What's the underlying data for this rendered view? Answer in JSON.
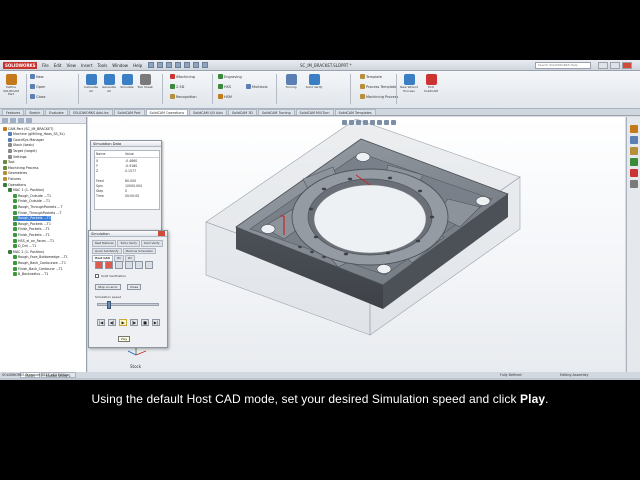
{
  "app": {
    "logo_text": "SOLIDWORKS",
    "menu": [
      "File",
      "Edit",
      "View",
      "Insert",
      "Tools",
      "Window",
      "Help"
    ],
    "document_title": "SC_IM_BRACKET.SLDPRT *",
    "search_placeholder": "Search SOLIDWORKS Help"
  },
  "ribbon": {
    "buttons": [
      {
        "label": "Define SOLIDCAM Part",
        "icon": "camworks-part-icon"
      },
      {
        "label": "New",
        "icon": "new-icon"
      },
      {
        "label": "Open",
        "icon": "open-icon"
      },
      {
        "label": "Close",
        "icon": "close-doc-icon"
      },
      {
        "label": "Calculate All",
        "icon": "calculate-icon"
      },
      {
        "label": "Generate All",
        "icon": "generate-icon"
      },
      {
        "label": "Simulate",
        "icon": "simulate-icon"
      },
      {
        "label": "Tool Sheet",
        "icon": "tool-sheet-icon"
      },
      {
        "label": "iMachining",
        "icon": "imachining-icon"
      },
      {
        "label": "2.5D",
        "icon": "milling-25d-icon"
      },
      {
        "label": "Recognition",
        "icon": "recognition-icon"
      },
      {
        "label": "Engraving",
        "icon": "engraving-icon"
      },
      {
        "label": "HSS",
        "icon": "hss-icon"
      },
      {
        "label": "HSM",
        "icon": "hsm-icon"
      },
      {
        "label": "Multiaxis",
        "icon": "multiaxis-icon"
      },
      {
        "label": "Turning",
        "icon": "turning-icon"
      },
      {
        "label": "Solid Verify",
        "icon": "verify-icon"
      },
      {
        "label": "Template",
        "icon": "template-icon"
      },
      {
        "label": "Process Template",
        "icon": "process-template-icon"
      },
      {
        "label": "Machining Process",
        "icon": "machining-process-icon"
      },
      {
        "label": "New Wizard Process",
        "icon": "wizard-icon"
      },
      {
        "label": "Exit SolidCAM",
        "icon": "exit-icon"
      }
    ]
  },
  "tabs": [
    "Features",
    "Sketch",
    "Evaluate",
    "SOLIDWORKS Add-Ins",
    "SolidCAM Part",
    "SolidCAM Operations",
    "SolidCAM 4/5 Axis",
    "SolidCAM 3D",
    "SolidCAM Turning",
    "SolidCAM Mill-Turn",
    "SolidCAM Templates"
  ],
  "tabs_active_index": 5,
  "tree": {
    "items": [
      {
        "label": "CAM-Part (SC_IM_BRACKET)",
        "indent": 0,
        "icon": "cam-part-icon",
        "color": "#c47a1b"
      },
      {
        "label": "Machine (gMilling_Haas_SS_3x)",
        "indent": 1,
        "icon": "machine-icon",
        "color": "#5b7fb5"
      },
      {
        "label": "CoordSys Manager",
        "indent": 1,
        "icon": "coordsys-icon",
        "color": "#5b7fb5"
      },
      {
        "label": "Stock (basic)",
        "indent": 1,
        "icon": "stock-icon",
        "color": "#8a8a8a"
      },
      {
        "label": "Target (target)",
        "indent": 1,
        "icon": "target-icon",
        "color": "#8a8a8a"
      },
      {
        "label": "Settings",
        "indent": 1,
        "icon": "settings-icon",
        "color": "#8a8a8a"
      },
      {
        "label": "Tool",
        "indent": 0,
        "icon": "tool-icon",
        "color": "#6a8a3a"
      },
      {
        "label": "Machining Process",
        "indent": 0,
        "icon": "process-icon",
        "color": "#6a8a3a"
      },
      {
        "label": "Geometries",
        "indent": 0,
        "icon": "geometries-icon",
        "color": "#b58f3a"
      },
      {
        "label": "Fixtures",
        "indent": 0,
        "icon": "fixtures-icon",
        "color": "#b58f3a"
      },
      {
        "label": "Operations",
        "indent": 0,
        "icon": "operations-icon",
        "color": "#3a7a3a"
      },
      {
        "label": "MAC 1 (1- Position)",
        "indent": 1,
        "icon": "mac-icon",
        "color": "#3a7a3a"
      },
      {
        "label": "Rough_Outside ...T1",
        "indent": 2,
        "icon": "op-icon",
        "color": "#3a9a3a"
      },
      {
        "label": "Finish_Outside ...T1",
        "indent": 2,
        "icon": "op-icon",
        "color": "#3a9a3a"
      },
      {
        "label": "Rough_ThroughPockets ...T",
        "indent": 2,
        "icon": "op-icon",
        "color": "#3a9a3a"
      },
      {
        "label": "Finish_ThroughPockets ...T",
        "indent": 2,
        "icon": "op-icon",
        "color": "#3a9a3a"
      },
      {
        "label": "Rough_Pockets ...T1",
        "indent": 2,
        "icon": "op-icon",
        "color": "#3a9a3a",
        "selected": true
      },
      {
        "label": "Rough_Pockets ...T1",
        "indent": 2,
        "icon": "op-icon",
        "color": "#3a9a3a"
      },
      {
        "label": "Finish_Pockets ...T1",
        "indent": 2,
        "icon": "op-icon",
        "color": "#3a9a3a"
      },
      {
        "label": "Finish_Pockets ...T1",
        "indent": 2,
        "icon": "op-icon",
        "color": "#3a9a3a"
      },
      {
        "label": "HSS_el_on_Faces ...T1",
        "indent": 2,
        "icon": "op-icon",
        "color": "#3a9a3a"
      },
      {
        "label": "D_Dril ...T1",
        "indent": 2,
        "icon": "op-icon",
        "color": "#3a9a3a"
      },
      {
        "label": "MAC 2 (1- Position)",
        "indent": 1,
        "icon": "mac-icon",
        "color": "#3a7a3a"
      },
      {
        "label": "Rough_Face_Bottomedge ...T1",
        "indent": 2,
        "icon": "op-icon",
        "color": "#3a9a3a"
      },
      {
        "label": "Rough_Back_Contourwa ...T1",
        "indent": 2,
        "icon": "op-icon",
        "color": "#3a9a3a"
      },
      {
        "label": "Finish_Back_Contourw ...T1",
        "indent": 2,
        "icon": "op-icon",
        "color": "#3a9a3a"
      },
      {
        "label": "B_Backradius ...T1",
        "indent": 2,
        "icon": "op-icon",
        "color": "#3a9a3a"
      }
    ]
  },
  "sim_data": {
    "title": "Simulation Data",
    "header": [
      "Name",
      "Value"
    ],
    "rows": [
      {
        "name": "X",
        "value": "-0.4860"
      },
      {
        "name": "Y",
        "value": "-0.9180"
      },
      {
        "name": "Z",
        "value": "0.1577"
      },
      {
        "name": "Feed",
        "value": "60.000"
      },
      {
        "name": "Spin",
        "value": "10000.000"
      },
      {
        "name": "Step",
        "value": "0"
      },
      {
        "name": "Time",
        "value": "00:00:00"
      }
    ]
  },
  "sim_dialog": {
    "title": "Simulation",
    "mode_tabs": [
      "Rest Material",
      "Turbo Verify",
      "Solid Verify",
      "Quick SolidVerify",
      "Machine Simulation",
      "Host CAD",
      "3D",
      "2D"
    ],
    "active_mode": "Host CAD",
    "toolbar_icons": [
      "tool-display-icon",
      "tool-holder-icon",
      "toolpath-icon",
      "rapid-icon",
      "stock-display-icon",
      "target-display-icon"
    ],
    "checkbox_label": "Solid Verification",
    "stop_button": "Stop on error",
    "close_button": "Close",
    "speed_label": "Simulation speed",
    "speed_fraction": 0.15,
    "play_controls": [
      "to-start-icon",
      "step-back-icon",
      "play-icon",
      "step-forward-icon",
      "stop-icon",
      "to-end-icon"
    ],
    "tooltip": "Play"
  },
  "viewport": {
    "tools": [
      "zoom-fit-icon",
      "zoom-area-icon",
      "previous-view-icon",
      "section-view-icon",
      "view-orientation-icon",
      "display-style-icon",
      "hide-show-icon",
      "appearance-icon"
    ],
    "triad_label": "Stock"
  },
  "bottom_tabs": [
    "Model",
    "Motion Study 1"
  ],
  "status": {
    "left": "SOLIDWORKS Premium 2017 x64 Edition",
    "mid": "Fully Defined",
    "right": "Editing Assembly"
  },
  "caption": {
    "pre": "Using the default Host CAD mode, set your desired Simulation speed and click ",
    "bold": "Play",
    "post": "."
  }
}
